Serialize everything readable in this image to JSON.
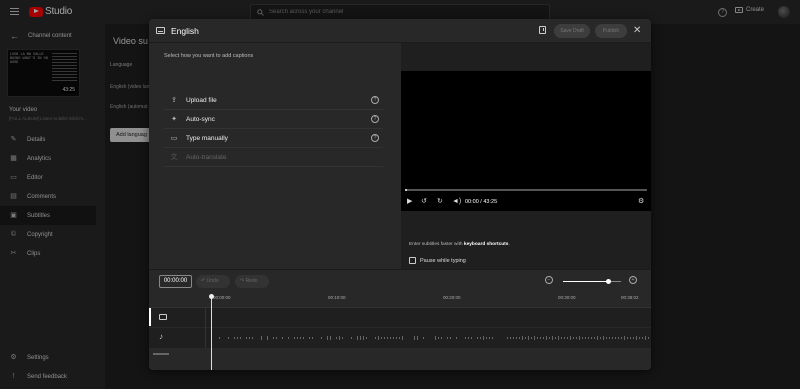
{
  "app": {
    "logo_text": "Studio",
    "brand_color": "#ff0000"
  },
  "search": {
    "placeholder": "Search across your channel"
  },
  "topbar": {
    "create_label": "Create"
  },
  "sidebar": {
    "back_label": "Channel content",
    "thumbnail": {
      "duration": "43:25",
      "text": "LOOK LA MA VALLE BUONO WHAT'S IN ON ASSE"
    },
    "your_video_label": "Your video",
    "video_name": "[FULL ALBUM] Listen to Billie Eilish's...",
    "items": [
      {
        "label": "Details",
        "icon": "pencil-icon"
      },
      {
        "label": "Analytics",
        "icon": "analytics-icon"
      },
      {
        "label": "Editor",
        "icon": "editor-icon"
      },
      {
        "label": "Comments",
        "icon": "comments-icon"
      },
      {
        "label": "Subtitles",
        "icon": "subtitles-icon",
        "active": true
      },
      {
        "label": "Copyright",
        "icon": "copyright-icon"
      },
      {
        "label": "Clips",
        "icon": "clips-icon"
      }
    ],
    "bottom_items": [
      {
        "label": "Settings",
        "icon": "gear-icon"
      },
      {
        "label": "Send feedback",
        "icon": "feedback-icon"
      }
    ]
  },
  "background_page": {
    "title": "Video su",
    "language_label": "Language",
    "row1": "English (video lan",
    "row2": "English (automat",
    "add_language": "Add languag"
  },
  "modal": {
    "title": "English",
    "save_draft": "Save Draft",
    "publish": "Publish",
    "hint": "Select how you want to add captions",
    "options": [
      {
        "label": "Upload file",
        "icon": "upload-icon",
        "enabled": true
      },
      {
        "label": "Auto-sync",
        "icon": "auto-sync-icon",
        "enabled": true
      },
      {
        "label": "Type manually",
        "icon": "keyboard-icon",
        "enabled": true
      },
      {
        "label": "Auto-translate",
        "icon": "translate-icon",
        "enabled": false
      }
    ],
    "player": {
      "time_current": "00:00",
      "time_total": "43:25",
      "progress": 0.01
    },
    "keyboard_tip_prefix": "Enter subtitles faster with ",
    "keyboard_tip_link": "keyboard shortcuts",
    "keyboard_tip_suffix": ".",
    "pause_label": "Pause while typing",
    "pause_checked": false
  },
  "timeline": {
    "timecode": "00:00:00",
    "undo": "Undo",
    "redo": "Redo",
    "zoom_level": 0.78,
    "ticks": [
      "00:00:00",
      "00:10:00",
      "00:20:00",
      "00:30:00",
      "00:38:02"
    ]
  }
}
